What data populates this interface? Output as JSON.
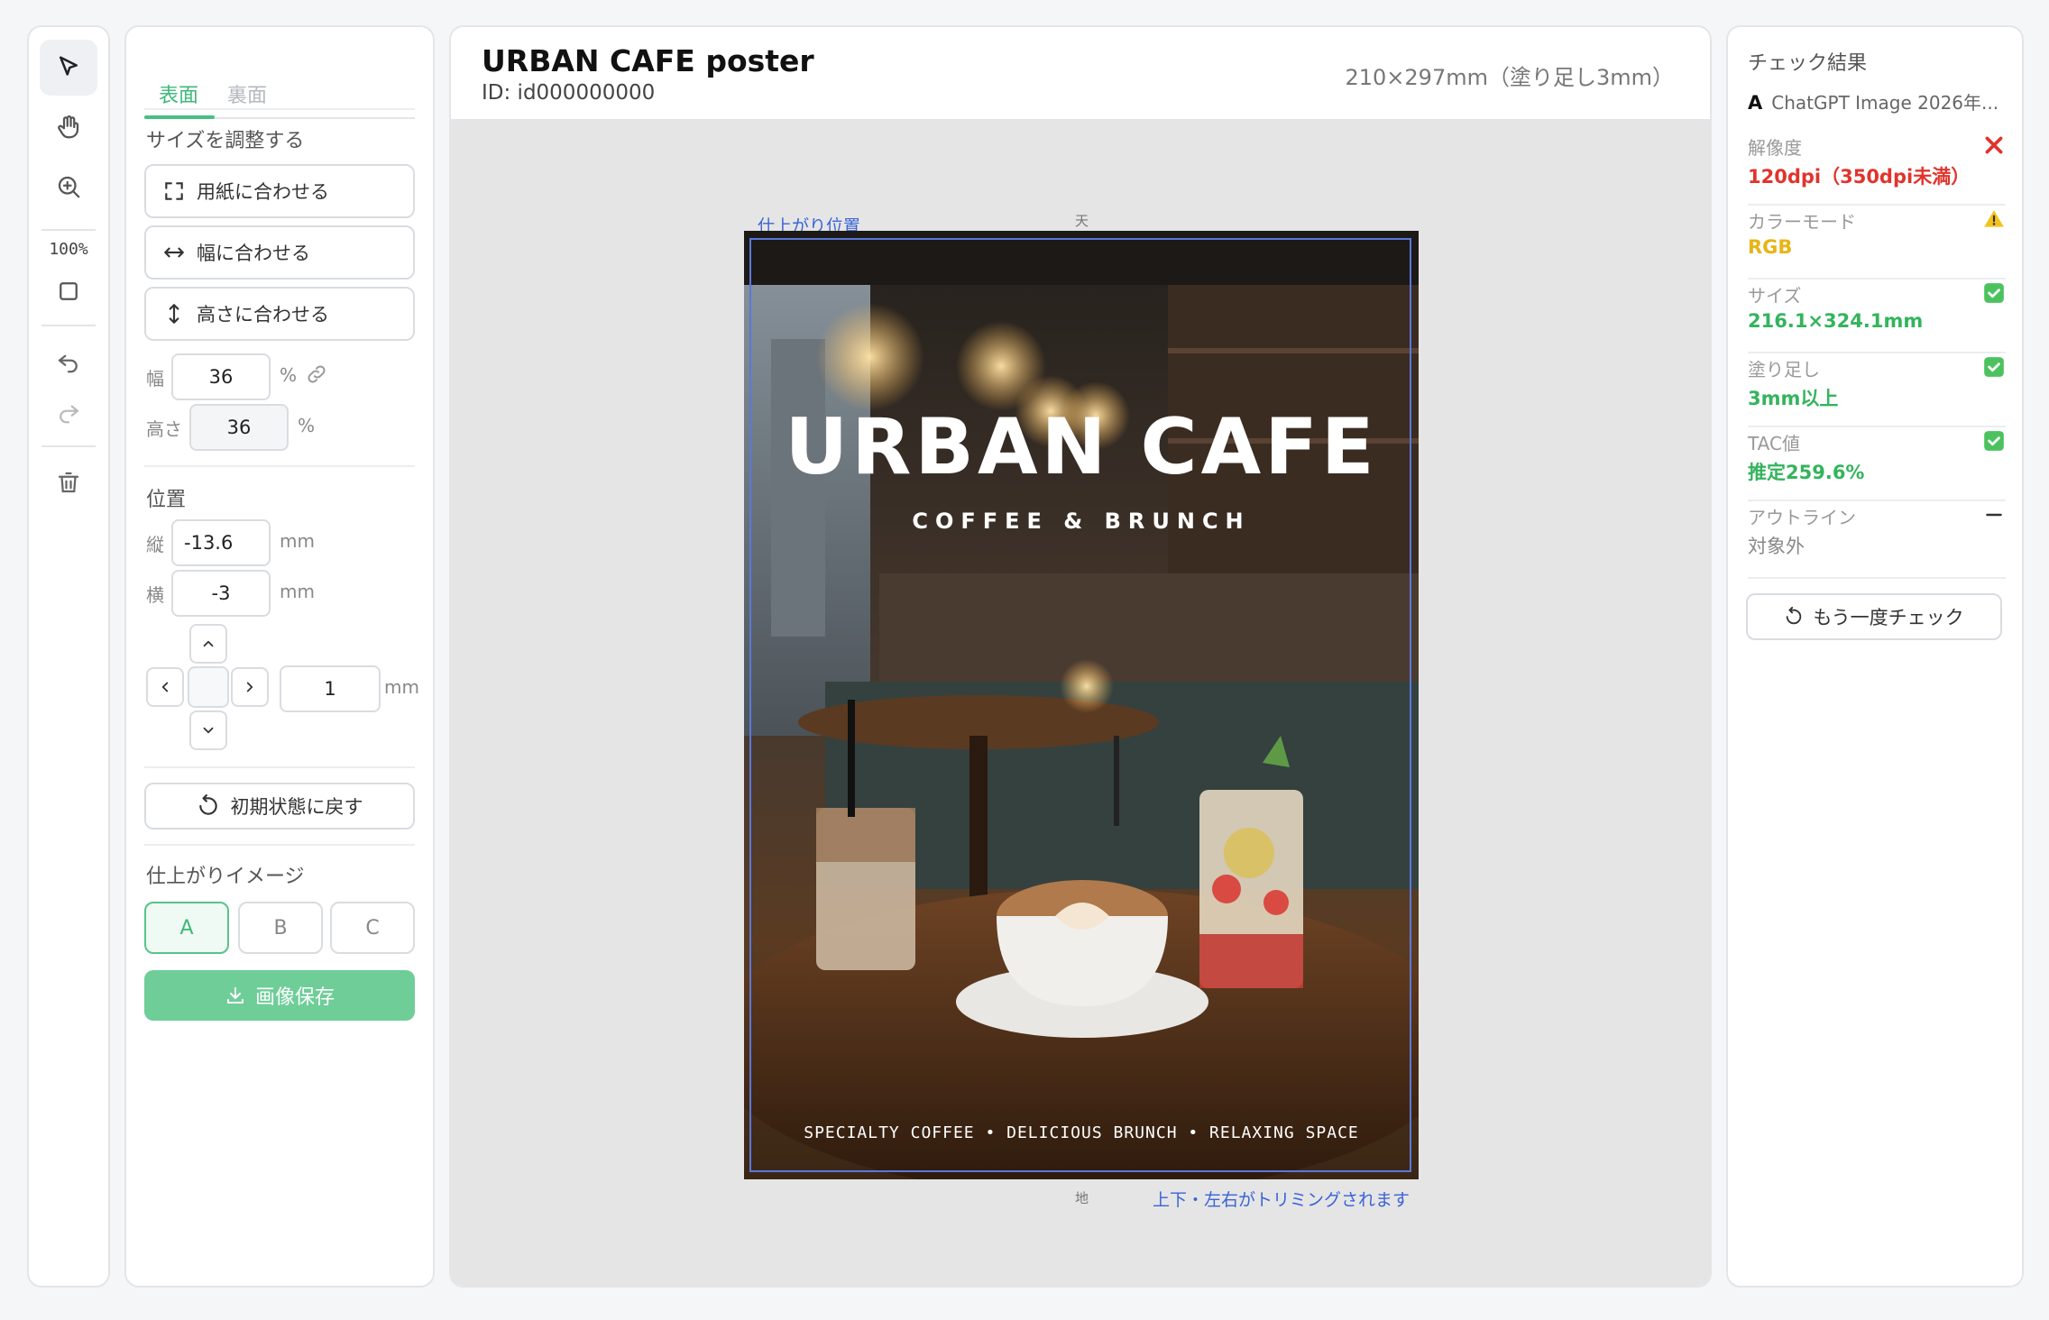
{
  "rail": {
    "zoom": "100%"
  },
  "settings": {
    "tabs": [
      {
        "label": "表面"
      },
      {
        "label": "裏面"
      }
    ],
    "resize": {
      "title": "サイズを調整する",
      "fit_paper": "用紙に合わせる",
      "fit_width": "幅に合わせる",
      "fit_height": "高さに合わせる",
      "width_label": "幅",
      "width_value": "36",
      "width_unit": "%",
      "height_label": "高さ",
      "height_value": "36",
      "height_unit": "%"
    },
    "position": {
      "title": "位置",
      "vertical_label": "縦",
      "vertical_value": "-13.6",
      "vertical_unit": "mm",
      "horizontal_label": "横",
      "horizontal_value": "-3",
      "horizontal_unit": "mm",
      "step_value": "1",
      "step_unit": "mm"
    },
    "reset_label": "初期状態に戻す",
    "preview": {
      "title": "仕上がりイメージ",
      "options": [
        "A",
        "B",
        "C"
      ],
      "selected": "A"
    },
    "save_label": "画像保存"
  },
  "main": {
    "title": "URBAN CAFE poster",
    "id_text": "ID: id000000000",
    "size_text": "210×297mm（塗り足し3mm）",
    "trim_label": "仕上がり位置",
    "top_mark": "天",
    "bottom_mark": "地",
    "trim_note": "上下・左右がトリミングされます",
    "poster": {
      "title": "URBAN CAFE",
      "subtitle": "COFFEE & BRUNCH",
      "footer": "SPECIALTY COFFEE • DELICIOUS BRUNCH  • RELAXING SPACE"
    }
  },
  "results": {
    "title": "チェック結果",
    "file_badge": "A",
    "file_name": "ChatGPT Image 2026年...",
    "items": [
      {
        "label": "解像度",
        "value": "120dpi（350dpi未満）",
        "status": "error",
        "color": "#e0342c"
      },
      {
        "label": "カラーモード",
        "value": "RGB",
        "status": "warning",
        "color": "#e8b416"
      },
      {
        "label": "サイズ",
        "value": "216.1×324.1mm",
        "status": "ok",
        "color": "#34b45c"
      },
      {
        "label": "塗り足し",
        "value": "3mm以上",
        "status": "ok",
        "color": "#34b45c"
      },
      {
        "label": "TAC値",
        "value": "推定259.6%",
        "status": "ok",
        "color": "#34b45c"
      },
      {
        "label": "アウトライン",
        "value": "対象外",
        "status": "na",
        "color": "#888888"
      }
    ],
    "recheck_label": "もう一度チェック"
  }
}
